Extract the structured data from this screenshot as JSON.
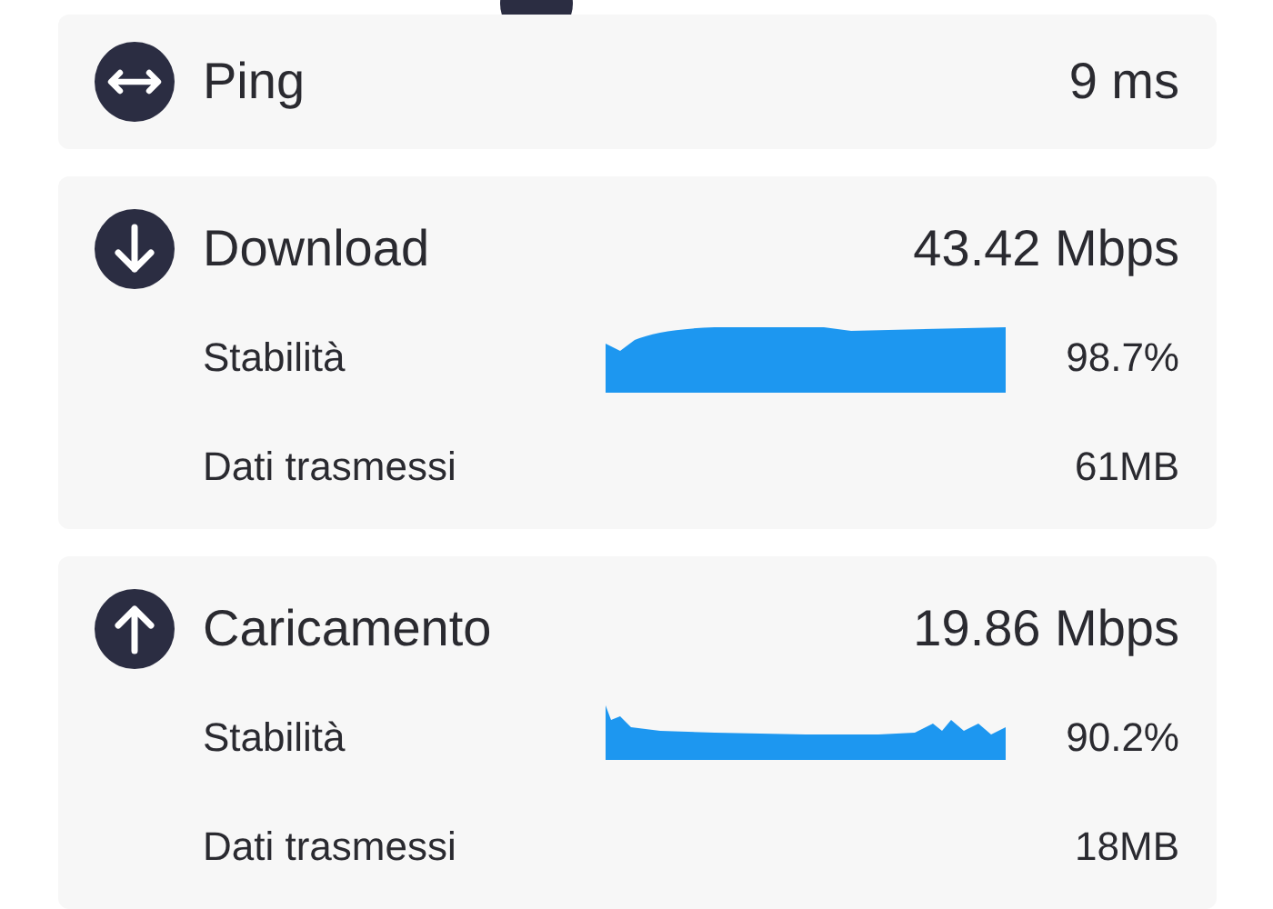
{
  "metrics": [
    {
      "kind": "ping",
      "label": "Ping",
      "value": "9 ms"
    },
    {
      "kind": "download",
      "label": "Download",
      "value": "43.42 Mbps",
      "rows": [
        {
          "kind": "graph",
          "label": "Stabilità",
          "value": "98.7%"
        },
        {
          "kind": "plain",
          "label": "Dati trasmessi",
          "value": "61MB"
        }
      ]
    },
    {
      "kind": "upload",
      "label": "Caricamento",
      "value": "19.86 Mbps",
      "rows": [
        {
          "kind": "graph",
          "label": "Stabilità",
          "value": "90.2%"
        },
        {
          "kind": "plain",
          "label": "Dati trasmessi",
          "value": "18MB"
        }
      ]
    }
  ]
}
